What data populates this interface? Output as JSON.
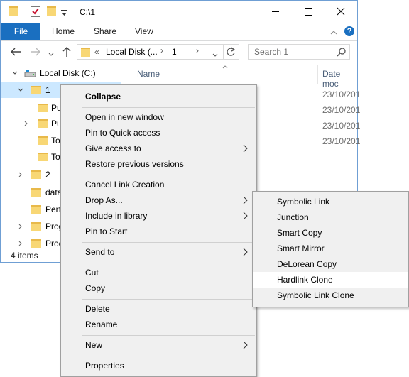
{
  "window": {
    "title": "C:\\1",
    "controls": {
      "minimize": "minimize",
      "maximize": "maximize",
      "close": "close"
    }
  },
  "ribbon": {
    "tabs": [
      "File",
      "Home",
      "Share",
      "View"
    ]
  },
  "address": {
    "chevrons": "«",
    "segments": [
      "Local Disk (...",
      "1"
    ],
    "search_placeholder": "Search 1"
  },
  "nav_tree": [
    {
      "label": "Local Disk (C:)",
      "icon": "drive-icon"
    },
    {
      "label": "1",
      "icon": "folder-icon"
    },
    {
      "label": "Pu",
      "icon": "folder-icon"
    },
    {
      "label": "Pu",
      "icon": "shared-folder-icon"
    },
    {
      "label": "To",
      "icon": "folder-icon"
    },
    {
      "label": "To",
      "icon": "folder-icon"
    },
    {
      "label": "2",
      "icon": "folder-icon"
    },
    {
      "label": "data",
      "icon": "folder-icon"
    },
    {
      "label": "Perf",
      "icon": "folder-icon"
    },
    {
      "label": "Prog",
      "icon": "folder-icon"
    },
    {
      "label": "Proc",
      "icon": "folder-icon"
    }
  ],
  "columns": {
    "name": "Name",
    "date": "Date moc"
  },
  "dates": [
    "23/10/201",
    "23/10/201",
    "23/10/201",
    "23/10/201"
  ],
  "status": "4 items",
  "context_menu": {
    "items": [
      {
        "label": "Collapse",
        "bold": true
      },
      {
        "label": "Open in new window"
      },
      {
        "label": "Pin to Quick access"
      },
      {
        "label": "Give access to",
        "submenu": true
      },
      {
        "label": "Restore previous versions"
      },
      {
        "label": "Cancel Link Creation"
      },
      {
        "label": "Drop As...",
        "submenu": true
      },
      {
        "label": "Include in library",
        "submenu": true
      },
      {
        "label": "Pin to Start"
      },
      {
        "label": "Send to",
        "submenu": true
      },
      {
        "label": "Cut"
      },
      {
        "label": "Copy"
      },
      {
        "label": "Delete"
      },
      {
        "label": "Rename"
      },
      {
        "label": "New",
        "submenu": true
      },
      {
        "label": "Properties"
      }
    ]
  },
  "submenu": {
    "items": [
      "Symbolic Link",
      "Junction",
      "Smart Copy",
      "Smart Mirror",
      "DeLorean Copy",
      "Hardlink Clone",
      "Symbolic Link Clone"
    ],
    "highlighted": "Hardlink Clone"
  },
  "colors": {
    "accent": "#1a6fc0",
    "selection": "#cce8ff",
    "folder": "#f8d775"
  }
}
